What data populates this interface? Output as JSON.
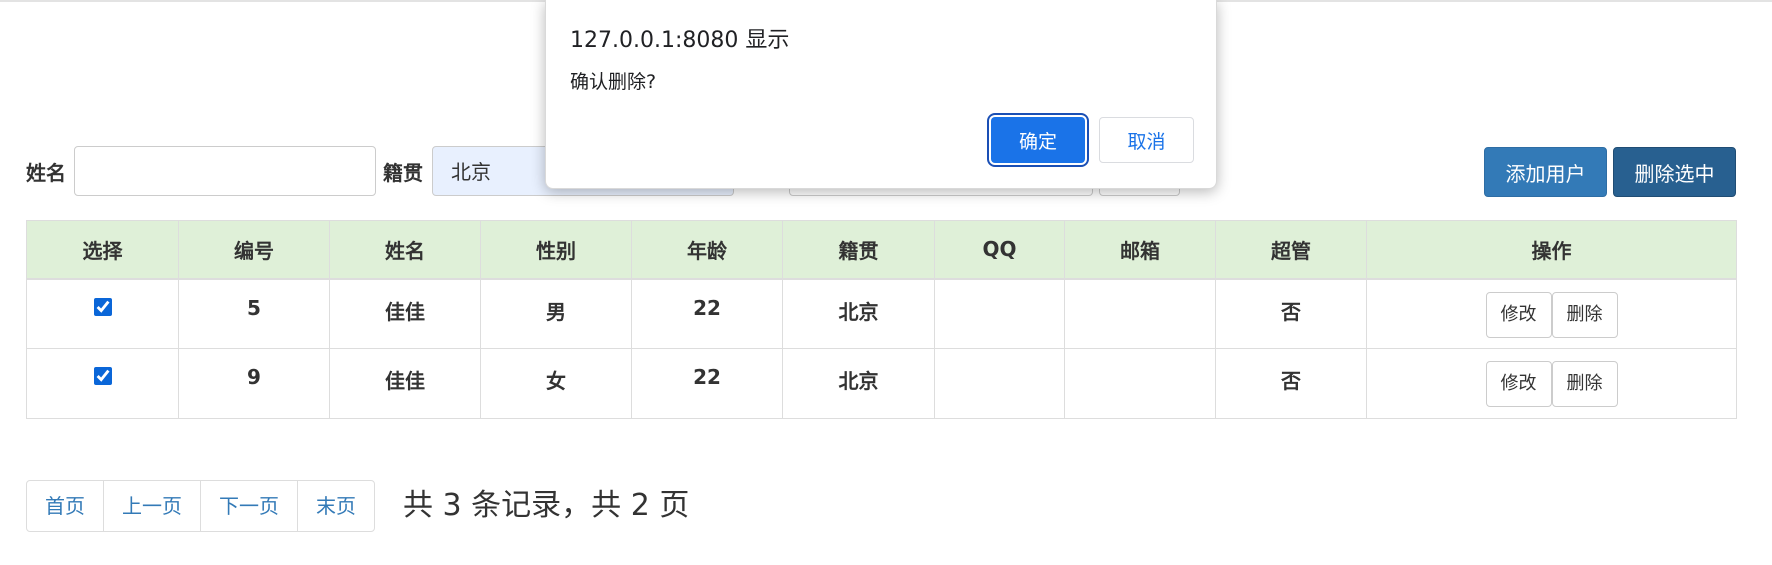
{
  "search": {
    "name_label": "姓名",
    "name_value": "",
    "origin_label": "籍贯",
    "origin_value": "北京",
    "add_button": "添加用户",
    "delete_selected_button": "删除选中"
  },
  "table": {
    "headers": [
      "选择",
      "编号",
      "姓名",
      "性别",
      "年龄",
      "籍贯",
      "QQ",
      "邮箱",
      "超管",
      "操作"
    ],
    "rows": [
      {
        "checked": true,
        "id": "5",
        "name": "佳佳",
        "gender": "男",
        "age": "22",
        "origin": "北京",
        "qq": "",
        "email": "",
        "admin": "否",
        "edit": "修改",
        "delete": "删除"
      },
      {
        "checked": true,
        "id": "9",
        "name": "佳佳",
        "gender": "女",
        "age": "22",
        "origin": "北京",
        "qq": "",
        "email": "",
        "admin": "否",
        "edit": "修改",
        "delete": "删除"
      }
    ]
  },
  "pagination": {
    "first": "首页",
    "prev": "上一页",
    "next": "下一页",
    "last": "末页",
    "info": "共 3 条记录，共 2 页"
  },
  "dialog": {
    "title": "127.0.0.1:8080 显示",
    "message": "确认删除?",
    "ok": "确定",
    "cancel": "取消"
  },
  "colors": {
    "header_bg": "#dff0d8",
    "primary": "#337ab7",
    "primary_dark": "#286090",
    "dialog_ok": "#1a73e8"
  }
}
